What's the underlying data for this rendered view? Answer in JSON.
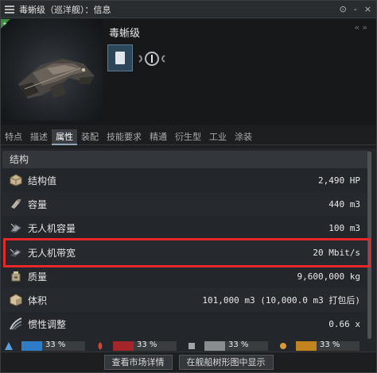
{
  "window": {
    "title": "毒蜥级（巡洋舰）：信息",
    "controls": [
      "⊙",
      "-",
      "×"
    ]
  },
  "ship": {
    "name": "毒蜥级",
    "collapse_chevrons": "«»"
  },
  "tabs": [
    "特点",
    "描述",
    "属性",
    "装配",
    "技能要求",
    "精通",
    "衍生型",
    "工业",
    "涂装"
  ],
  "active_tab": "属性",
  "section": {
    "title": "结构"
  },
  "attributes": [
    {
      "label": "结构值",
      "value": "2,490 HP",
      "icon": "structure-icon"
    },
    {
      "label": "容量",
      "value": "440 m3",
      "icon": "cargo-capacity-icon"
    },
    {
      "label": "无人机容量",
      "value": "100 m3",
      "icon": "drone-capacity-icon"
    },
    {
      "label": "无人机带宽",
      "value": "20 Mbit/s",
      "icon": "drone-bandwidth-icon"
    },
    {
      "label": "质量",
      "value": "9,600,000 kg",
      "icon": "mass-icon"
    },
    {
      "label": "体积",
      "value": "101,000 m3 (10,000.0 m3 打包后)",
      "icon": "volume-icon"
    },
    {
      "label": "惯性调整",
      "value": "0.66 x",
      "icon": "inertia-icon"
    }
  ],
  "resistances": [
    {
      "name": "em-resist",
      "percent": "33 %",
      "fraction": 0.33,
      "color": "#2d7cc4"
    },
    {
      "name": "thermal-resist",
      "percent": "33 %",
      "fraction": 0.33,
      "color": "#a3262a"
    },
    {
      "name": "kinetic-resist",
      "percent": "33 %",
      "fraction": 0.33,
      "color": "#8a8d90"
    },
    {
      "name": "explosive-resist",
      "percent": "33 %",
      "fraction": 0.33,
      "color": "#c2841e"
    }
  ],
  "footer": {
    "market_button": "查看市场详情",
    "tree_button": "在舰船树形图中显示"
  }
}
